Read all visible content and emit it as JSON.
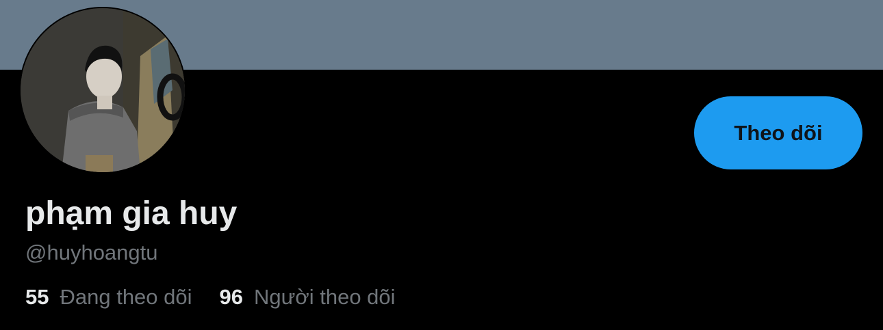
{
  "profile": {
    "display_name": "phạm gia huy",
    "handle": "@huyhoangtu",
    "follow_button_label": "Theo dõi",
    "avatar_icon": "user-avatar-photo"
  },
  "stats": {
    "following_count": "55",
    "following_label": "Đang theo dõi",
    "followers_count": "96",
    "followers_label": "Người theo dõi"
  },
  "colors": {
    "banner": "#687b8c",
    "background": "#000000",
    "accent": "#1d9bf0",
    "primary_text": "#e7e9ea",
    "secondary_text": "#71767b"
  }
}
